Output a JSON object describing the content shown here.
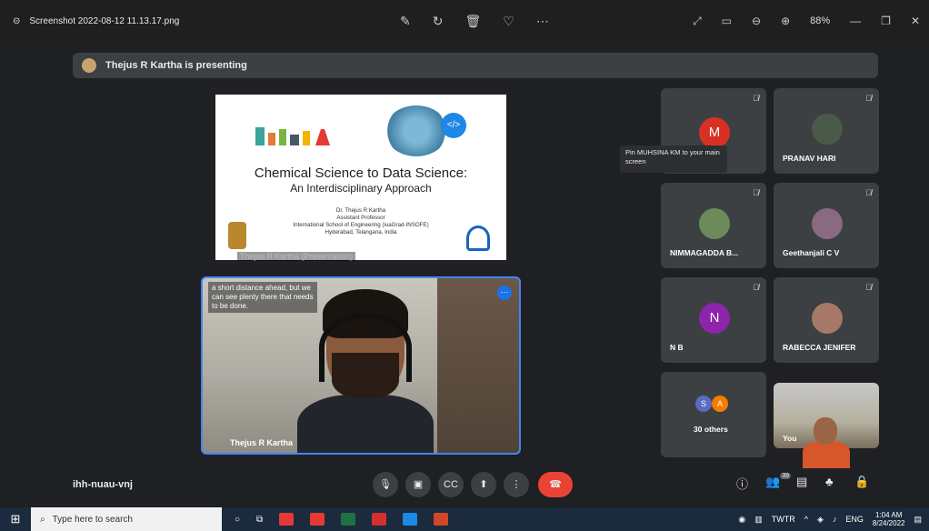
{
  "viewer": {
    "filename": "Screenshot 2022-08-12 11.13.17.png",
    "zoom": "88%"
  },
  "meet": {
    "presenting_text": "Thejus R Kartha is presenting",
    "slide": {
      "title_line1": "Chemical Science to Data Science:",
      "title_line2": "An Interdisciplinary Approach",
      "code_badge": "</>",
      "author": "Dr. Thejus R Kartha",
      "role": "Assistant Professor",
      "institution": "International School of Engineering (iuaGrad-INSOFE)",
      "location": "Hyderabad, Telangana, India"
    },
    "stage_caption": "Thejus R Kartha (Presentation)",
    "speaker": {
      "name": "Thejus R Kartha",
      "captions": "a short distance ahead, but we can see plenty there that needs to be done."
    },
    "tooltip": "Pin MUHSINA KM to your main screen",
    "tiles": [
      {
        "name": "",
        "initial": "M",
        "color": "#d93025"
      },
      {
        "name": "PRANAV HARI",
        "initial": "",
        "color": ""
      },
      {
        "name": "NIMMAGADDA B...",
        "initial": "",
        "color": ""
      },
      {
        "name": "Geethanjali C V",
        "initial": "",
        "color": ""
      },
      {
        "name": "N B",
        "initial": "N",
        "color": "#8e24aa"
      },
      {
        "name": "RABECCA JENIFER",
        "initial": "",
        "color": ""
      }
    ],
    "others": {
      "label": "30 others",
      "a": "S",
      "b": "A"
    },
    "you_label": "You",
    "meeting_code": "ihh-nuau-vnj",
    "participants_count": "39"
  },
  "taskbar": {
    "search_placeholder": "Type here to search",
    "tray_label": "TWTR",
    "lang": "ENG",
    "time": "1:04 AM",
    "date": "8/24/2022"
  }
}
